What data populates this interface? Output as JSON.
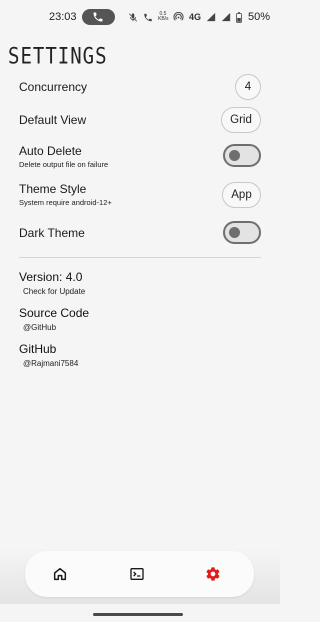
{
  "status_bar": {
    "time": "23:03",
    "net_speed_value": "0.5",
    "net_speed_unit": "KB/s",
    "network": "4G",
    "battery": "50%",
    "icons": [
      "call-icon",
      "mute-icon",
      "wifi-calling-icon",
      "hotspot-icon",
      "signal-icon",
      "battery-icon"
    ]
  },
  "header": {
    "title": "SETTINGS"
  },
  "settings": {
    "concurrency": {
      "label": "Concurrency",
      "value": "4"
    },
    "default_view": {
      "label": "Default View",
      "value": "Grid"
    },
    "auto_delete": {
      "label": "Auto Delete",
      "subtitle": "Delete output file on failure",
      "enabled": false
    },
    "theme_style": {
      "label": "Theme Style",
      "subtitle": "System require android-12+",
      "value": "App"
    },
    "dark_theme": {
      "label": "Dark Theme",
      "enabled": false
    }
  },
  "info": {
    "version": {
      "title": "Version: 4.0",
      "subtitle": "Check for Update"
    },
    "source": {
      "title": "Source Code",
      "subtitle": "@GitHub"
    },
    "github": {
      "title": "GitHub",
      "subtitle": "@Rajmani7584"
    }
  },
  "bottom_nav": {
    "items": [
      {
        "name": "home",
        "icon": "home-icon",
        "active": false
      },
      {
        "name": "terminal",
        "icon": "terminal-icon",
        "active": false
      },
      {
        "name": "settings",
        "icon": "gear-icon",
        "active": true
      }
    ],
    "active_color": "#e01b1b",
    "inactive_color": "#1a1a1a"
  }
}
